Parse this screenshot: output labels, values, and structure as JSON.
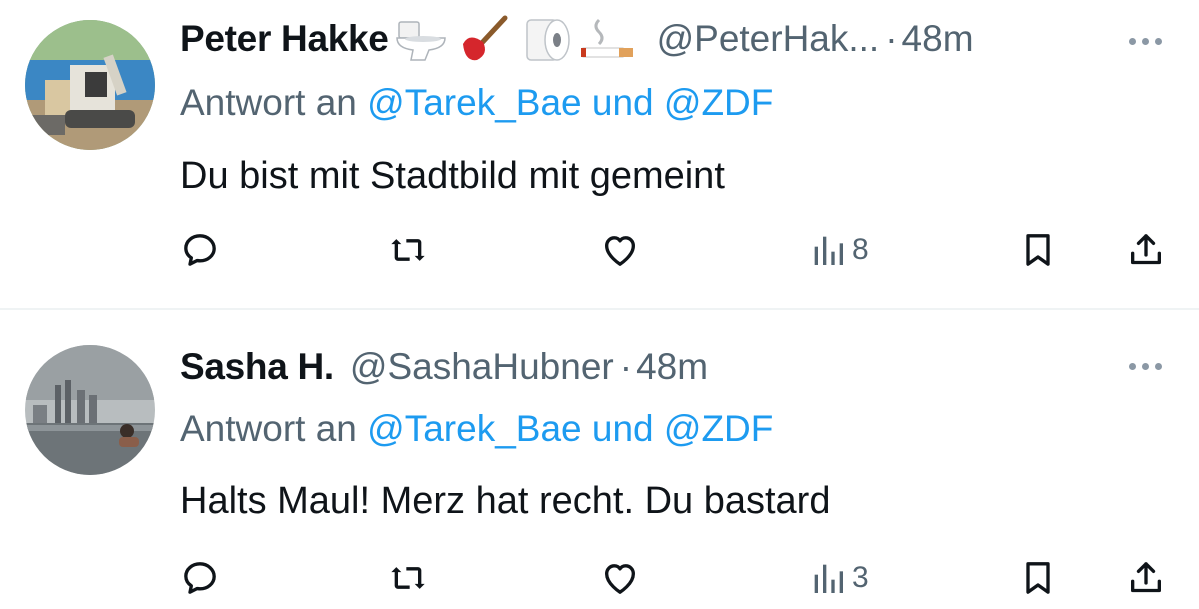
{
  "tweets": [
    {
      "display_name": "Peter Hakke",
      "name_emojis": [
        "toilet-icon",
        "plunger-icon",
        "toilet-paper-icon",
        "cigarette-icon"
      ],
      "handle": "@PeterHak...",
      "separator": "·",
      "time": "48m",
      "reply_prefix": "Antwort an",
      "reply_mentions": "@Tarek_Bae und @ZDF",
      "text": "Du bist mit Stadtbild mit gemeint",
      "views": "8",
      "avatar": "excavator-photo"
    },
    {
      "display_name": "Sasha H.",
      "name_emojis": [],
      "handle": "@SashaHubner",
      "separator": "·",
      "time": "48m",
      "reply_prefix": "Antwort an",
      "reply_mentions": "@Tarek_Bae und @ZDF",
      "text": "Halts Maul! Merz hat recht. Du bastard",
      "views": "3",
      "avatar": "skyline-pool-photo"
    }
  ],
  "colors": {
    "text": "#0f1419",
    "secondary": "#536471",
    "link": "#1d9bf0",
    "divider": "#eff3f4"
  }
}
